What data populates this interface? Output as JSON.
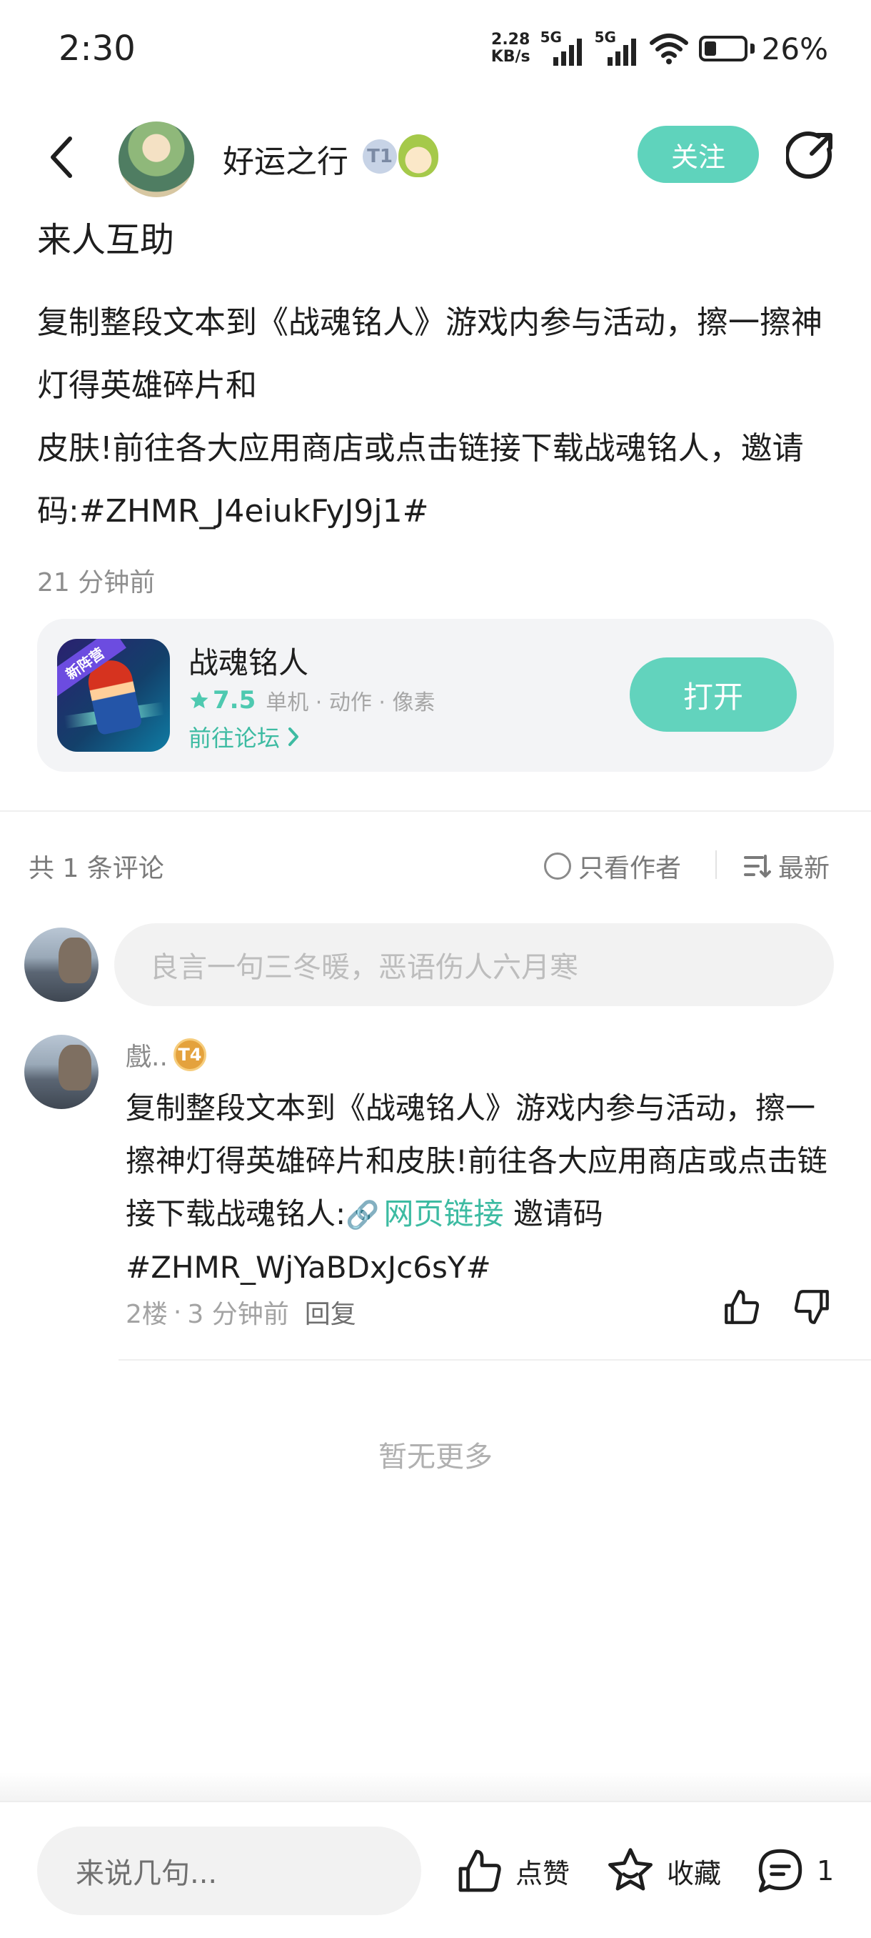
{
  "status_bar": {
    "time": "2:30",
    "net_speed_value": "2.28",
    "net_speed_unit": "KB/s",
    "sim1_tag": "5G",
    "sim2_tag": "5G",
    "battery_pct": "26%"
  },
  "header": {
    "author_name": "好运之行",
    "level_badge": "T1",
    "follow_label": "关注"
  },
  "post": {
    "title": "来人互助",
    "body": "复制整段文本到《战魂铭人》游戏内参与活动，擦一擦神灯得英雄碎片和\n皮肤!前往各大应用商店或点击链接下载战魂铭人，邀请码:#ZHMR_J4eiukFyJ9j1#",
    "time": "21 分钟前"
  },
  "game_card": {
    "ribbon": "新阵营",
    "name": "战魂铭人",
    "rating": "7.5",
    "tags": "单机 · 动作 · 像素",
    "forum_link": "前往论坛",
    "open_label": "打开"
  },
  "comments_header": {
    "count": "共 1 条评论",
    "only_author": "只看作者",
    "sort": "最新"
  },
  "comment_input": {
    "placeholder": "良言一句三冬暖，恶语伤人六月寒"
  },
  "comment": {
    "user": "戲..",
    "badge": "T4",
    "text_before_link": "复制整段文本到《战魂铭人》游戏内参与活动，擦一擦神灯得英雄碎片和皮肤!前往各大应用商店或点击链接下载战魂铭人:",
    "link_label": "网页链接",
    "text_after_link": " 邀请码#ZHMR_WjYaBDxJc6sY#",
    "floor": "2楼",
    "dot": "·",
    "time": "3 分钟前",
    "reply_label": "回复"
  },
  "no_more": "暂无更多",
  "bottom_bar": {
    "input_placeholder": "来说几句...",
    "like_label": "点赞",
    "favorite_label": "收藏",
    "comment_count": "1"
  },
  "colors": {
    "accent": "#5fd3bc",
    "accent_text": "#3dbba2",
    "muted_text": "#8e8e8e"
  },
  "icons": [
    "back-arrow-icon",
    "share-icon",
    "star-icon",
    "chevron-right-icon",
    "circle-radio-icon",
    "sort-lines-icon",
    "link-chain-icon",
    "thumb-up-icon",
    "thumb-down-icon",
    "star-outline-icon",
    "comment-bubble-icon"
  ]
}
